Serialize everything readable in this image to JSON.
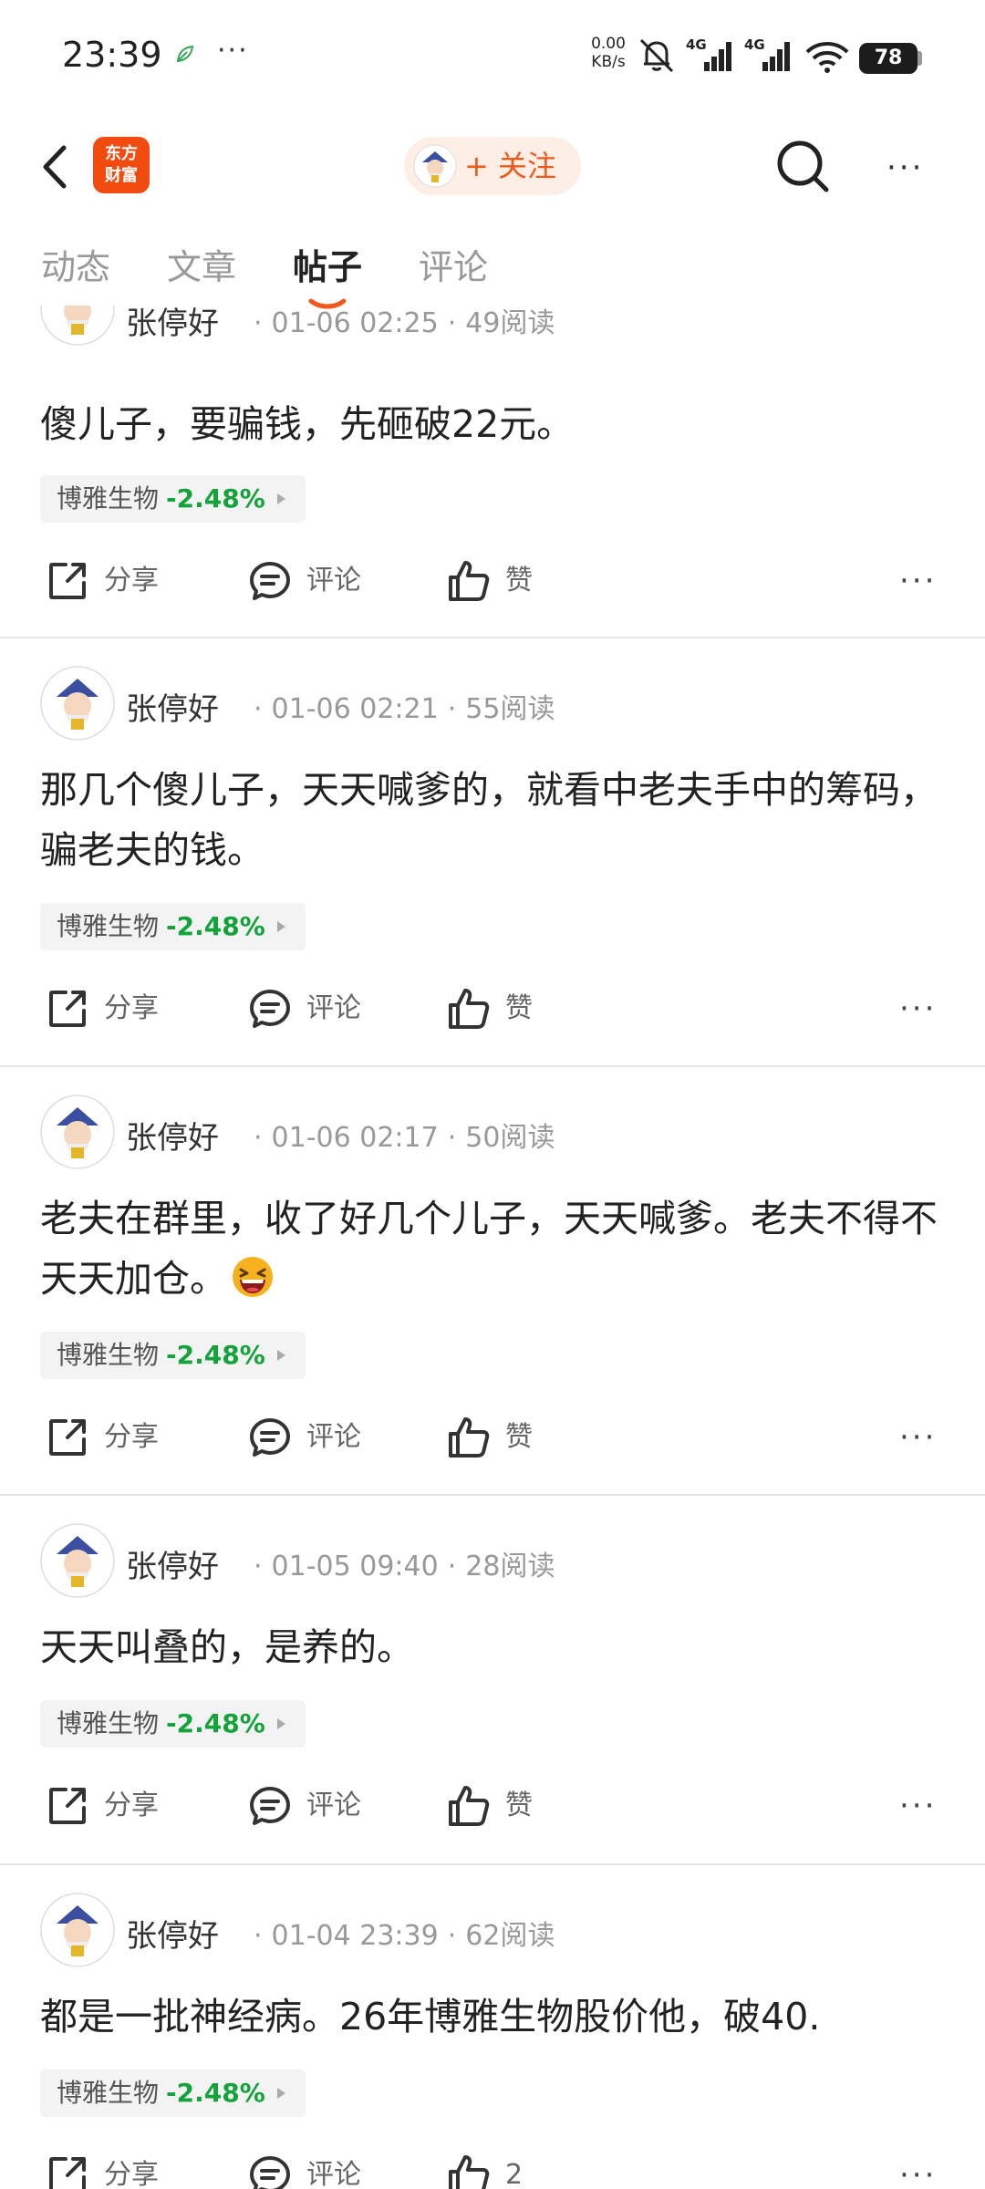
{
  "status_bar": {
    "time": "23:39",
    "more": "···",
    "net_speed": "0.00",
    "net_unit": "KB/s",
    "signal1": "4G",
    "signal2": "4G",
    "battery": "78"
  },
  "header": {
    "logo_line1": "东方",
    "logo_line2": "财富",
    "follow_label": "+ 关注",
    "more": "···"
  },
  "tabs": [
    {
      "label": "动态"
    },
    {
      "label": "文章"
    },
    {
      "label": "帖子"
    },
    {
      "label": "评论"
    }
  ],
  "active_tab": "帖子",
  "posts": [
    {
      "author": "张停好",
      "date": "01-06 02:25",
      "reads": "49阅读",
      "text": "傻儿子，要骗钱，先砸破22元。",
      "stock": "博雅生物",
      "change": "-2.48%",
      "share": "分享",
      "comment": "评论",
      "like": "赞"
    },
    {
      "author": "张停好",
      "date": "01-06 02:21",
      "reads": "55阅读",
      "text": "那几个傻儿子，天天喊爹的，就看中老夫手中的筹码，骗老夫的钱。",
      "stock": "博雅生物",
      "change": "-2.48%",
      "share": "分享",
      "comment": "评论",
      "like": "赞"
    },
    {
      "author": "张停好",
      "date": "01-06 02:17",
      "reads": "50阅读",
      "text": "老夫在群里，收了好几个儿子，天天喊爹。老夫不得不天天加仓。",
      "stock": "博雅生物",
      "change": "-2.48%",
      "share": "分享",
      "comment": "评论",
      "like": "赞"
    },
    {
      "author": "张停好",
      "date": "01-05 09:40",
      "reads": "28阅读",
      "text": "天天叫叠的，是养的。",
      "stock": "博雅生物",
      "change": "-2.48%",
      "share": "分享",
      "comment": "评论",
      "like": "赞"
    },
    {
      "author": "张停好",
      "date": "01-04 23:39",
      "reads": "62阅读",
      "text": "都是一批神经病。26年博雅生物股价他，破40.",
      "stock": "博雅生物",
      "change": "-2.48%",
      "share": "分享",
      "comment": "评论",
      "like": "2"
    }
  ],
  "post_more": "···",
  "colors": {
    "accent": "#f0591b",
    "logo_bg": "#f24b0f",
    "stock_down": "#14a33a"
  },
  "icons": [
    "back-arrow-icon",
    "search-icon",
    "share-icon",
    "comment-icon",
    "thumbs-up-icon",
    "laughing-emoji-icon"
  ]
}
